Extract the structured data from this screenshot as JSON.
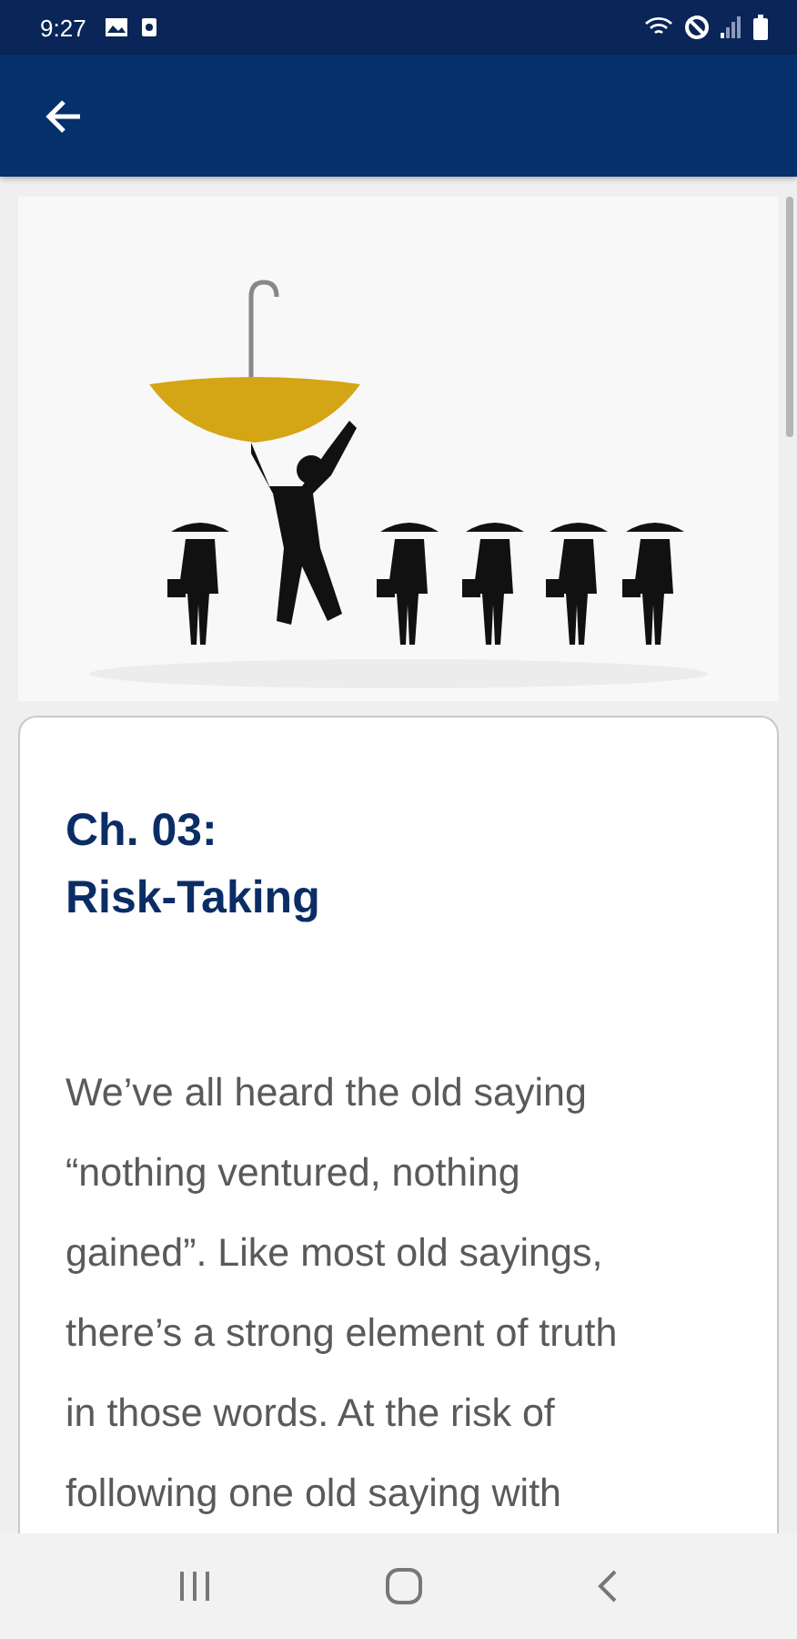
{
  "status_bar": {
    "time": "9:27"
  },
  "article": {
    "title_lines": [
      "Ch. 03:",
      "Risk-Taking"
    ],
    "body_lines": [
      "We’ve all heard the old saying",
      "“nothing ventured, nothing",
      "gained”. Like most old sayings,",
      "there’s a strong element of truth",
      "in those words. At the risk of",
      "following one old saying with"
    ]
  }
}
